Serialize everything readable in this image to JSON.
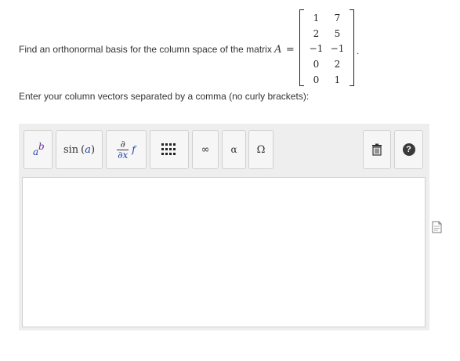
{
  "question": {
    "prefix": "Find an orthonormal basis for the column space of the matrix",
    "var": "A",
    "eq": "=",
    "period": "."
  },
  "matrix": {
    "rows": [
      [
        "1",
        "7"
      ],
      [
        "2",
        "5"
      ],
      [
        "−1",
        "−1"
      ],
      [
        "0",
        "2"
      ],
      [
        "0",
        "1"
      ]
    ]
  },
  "instruction": "Enter your column vectors separated by a comma (no curly brackets):",
  "toolbar": {
    "sin_func": "sin",
    "sin_arg": "a",
    "deriv_top": "∂",
    "deriv_bottom": "∂x",
    "deriv_f": "f",
    "infinity": "∞",
    "alpha": "α",
    "omega": "Ω",
    "help": "?"
  },
  "answer": {
    "value": ""
  },
  "icons": {
    "superscript": "superscript-icon",
    "matrix": "matrix-icon",
    "trash": "trash-icon",
    "help": "help-circle-icon",
    "document": "document-icon"
  }
}
